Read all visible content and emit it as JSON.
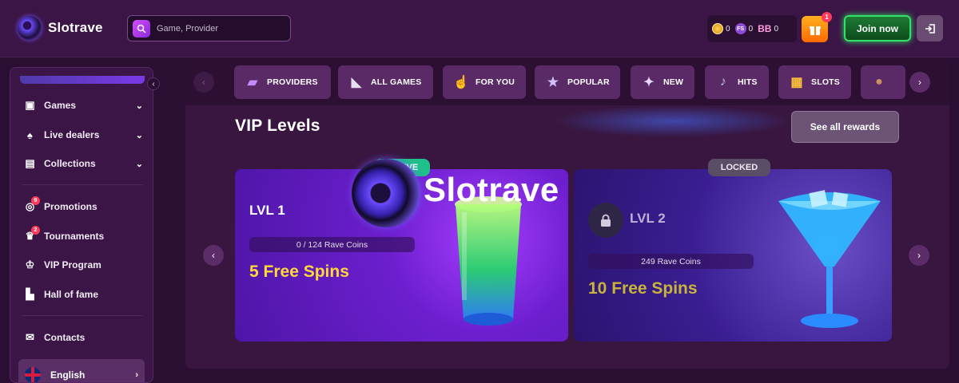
{
  "header": {
    "logo_text": "Slotrave",
    "search_placeholder": "Game, Provider",
    "balances": [
      {
        "icon": "rave-coin-icon",
        "value": "0"
      },
      {
        "icon": "free-spins-icon",
        "label": "FS",
        "value": "0"
      },
      {
        "icon": "bonus-balance-icon",
        "label": "BB",
        "value": "0"
      }
    ],
    "gift_badge": "1",
    "join_label": "Join now"
  },
  "sidebar": {
    "items": [
      {
        "label": "Games",
        "icon": "games-icon",
        "expandable": true
      },
      {
        "label": "Live dealers",
        "icon": "live-dealers-icon",
        "expandable": true
      },
      {
        "label": "Collections",
        "icon": "collections-icon",
        "expandable": true
      },
      {
        "label": "Promotions",
        "icon": "promotions-icon",
        "badge": "9"
      },
      {
        "label": "Tournaments",
        "icon": "tournaments-icon",
        "badge": "2"
      },
      {
        "label": "VIP Program",
        "icon": "crown-icon"
      },
      {
        "label": "Hall of fame",
        "icon": "podium-icon"
      },
      {
        "label": "Contacts",
        "icon": "chat-icon"
      }
    ],
    "language": "English"
  },
  "categories": [
    {
      "label": "PROVIDERS",
      "icon": "folder-icon"
    },
    {
      "label": "ALL GAMES",
      "icon": "megaphone-icon"
    },
    {
      "label": "FOR YOU",
      "icon": "pointing-hand-icon"
    },
    {
      "label": "POPULAR",
      "icon": "star-icon"
    },
    {
      "label": "NEW",
      "icon": "sparkle-icon"
    },
    {
      "label": "HITS",
      "icon": "microphone-icon"
    },
    {
      "label": "SLOTS",
      "icon": "slot-machine-icon"
    }
  ],
  "vip": {
    "title": "VIP Levels",
    "see_all": "See all rewards",
    "overlay_logo": "Slotrave",
    "levels": [
      {
        "status": "ACTIVE",
        "level": "LVL 1",
        "progress": "0 / 124 Rave Coins",
        "reward": "5 Free Spins"
      },
      {
        "status": "LOCKED",
        "level": "LVL 2",
        "progress": "249 Rave Coins",
        "reward": "10 Free Spins"
      }
    ]
  },
  "colors": {
    "background": "#2a0f33",
    "accent_green": "#34e06a",
    "reward_yellow": "#ffd93a",
    "active_badge": "#1fc08a"
  }
}
